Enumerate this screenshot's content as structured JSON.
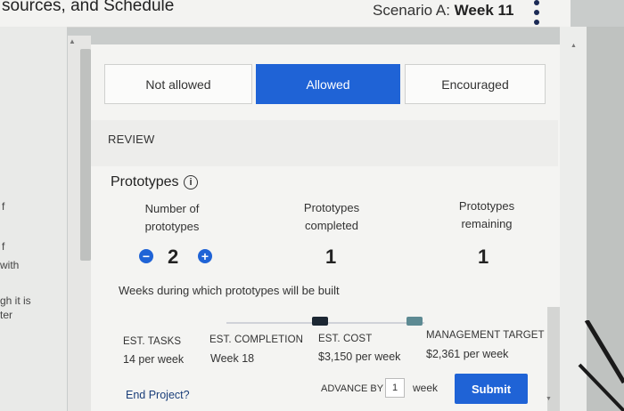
{
  "header": {
    "title": "sources, and Schedule",
    "scenario_prefix": "Scenario A: ",
    "scenario_week": "Week 11"
  },
  "left_panel": {
    "lines": [
      "f",
      "f",
      "with",
      "gh it is",
      "ter"
    ]
  },
  "tabs": [
    {
      "label": "Not allowed",
      "selected": false
    },
    {
      "label": "Allowed",
      "selected": true
    },
    {
      "label": "Encouraged",
      "selected": false
    }
  ],
  "review": {
    "label": "REVIEW"
  },
  "prototypes": {
    "heading": "Prototypes",
    "info_icon": "i",
    "number": {
      "label_line1": "Number of",
      "label_line2": "prototypes",
      "value": "2",
      "decrement": "−",
      "increment": "+"
    },
    "completed": {
      "label_line1": "Prototypes",
      "label_line2": "completed",
      "value": "1"
    },
    "remaining": {
      "label_line1": "Prototypes",
      "label_line2": "remaining",
      "value": "1"
    },
    "weeks_label": "Weeks during which prototypes will be built"
  },
  "stats": [
    {
      "heading": "EST. TASKS",
      "value": "14 per week"
    },
    {
      "heading": "EST. COMPLETION",
      "value": "Week 18"
    },
    {
      "heading": "EST. COST",
      "value": "$3,150 per week"
    },
    {
      "heading": "MANAGEMENT TARGET",
      "value": "$2,361 per week"
    }
  ],
  "footer": {
    "end_project": "End Project?",
    "advance_by_label": "ADVANCE BY",
    "advance_by_value": "1",
    "advance_unit": "week",
    "submit": "Submit"
  },
  "colors": {
    "accent": "#1f63d6",
    "marker_dark": "#1c2733",
    "marker_teal": "#5d8a93"
  }
}
